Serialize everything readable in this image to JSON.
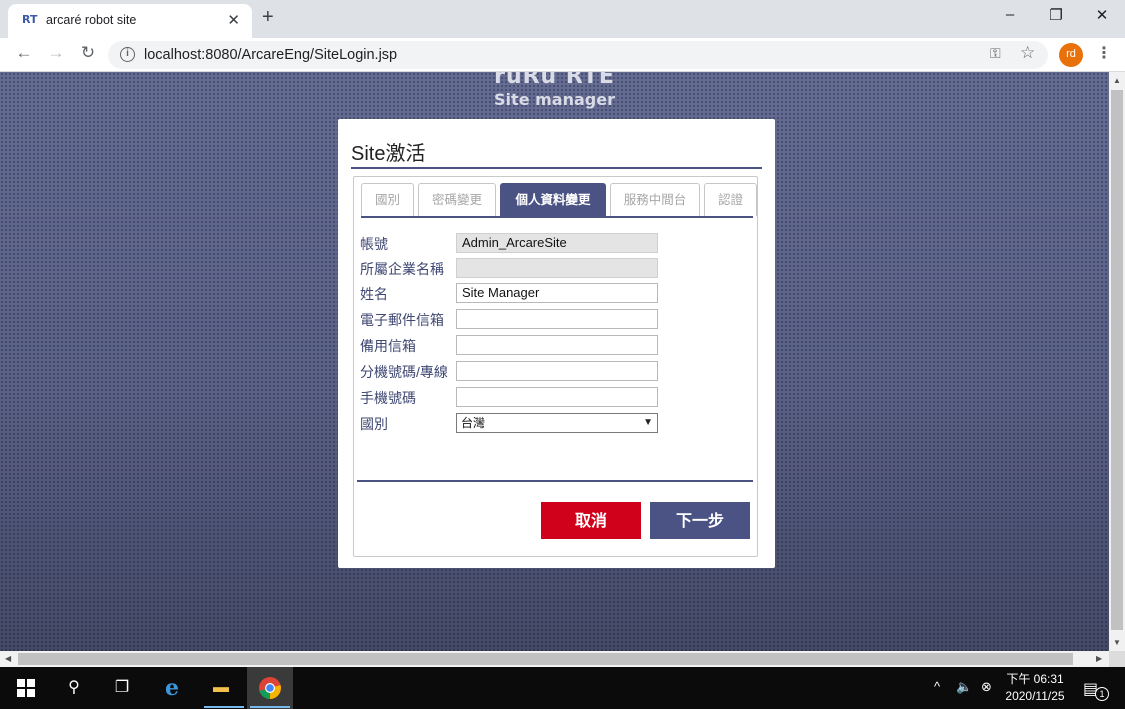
{
  "browser": {
    "tab_favicon": "RT",
    "tab_title": "arcaré robot site",
    "tab_close": "✕",
    "new_tab": "+",
    "url": "localhost:8080/ArcareEng/SiteLogin.jsp",
    "profile_initials": "rd",
    "window_controls": {
      "minimize": "–",
      "restore": "❐",
      "close": "✕"
    }
  },
  "page": {
    "brand_top": "ruRu RTE",
    "brand_sub": "Site manager"
  },
  "dialog": {
    "title": "Site激活",
    "tabs": [
      {
        "label": "國別",
        "active": false
      },
      {
        "label": "密碼變更",
        "active": false
      },
      {
        "label": "個人資料變更",
        "active": true
      },
      {
        "label": "服務中間台",
        "active": false
      },
      {
        "label": "認證",
        "active": false
      }
    ],
    "fields": [
      {
        "label": "帳號",
        "value": "Admin_ArcareSite",
        "disabled": true
      },
      {
        "label": "所屬企業名稱",
        "value": "",
        "disabled": true
      },
      {
        "label": "姓名",
        "value": "Site Manager",
        "disabled": false
      },
      {
        "label": "電子郵件信箱",
        "value": "",
        "disabled": false
      },
      {
        "label": "備用信箱",
        "value": "",
        "disabled": false
      },
      {
        "label": "分機號碼/專線",
        "value": "",
        "disabled": false
      },
      {
        "label": "手機號碼",
        "value": "",
        "disabled": false
      }
    ],
    "country": {
      "label": "國別",
      "selected": "台灣"
    },
    "buttons": {
      "cancel": "取消",
      "next": "下一步"
    }
  },
  "taskbar": {
    "clock_time": "下午 06:31",
    "clock_date": "2020/11/25",
    "notification_count": "1"
  },
  "colors": {
    "accent": "#4b5384",
    "cancel": "#d0021b",
    "profile": "#e8710a"
  }
}
